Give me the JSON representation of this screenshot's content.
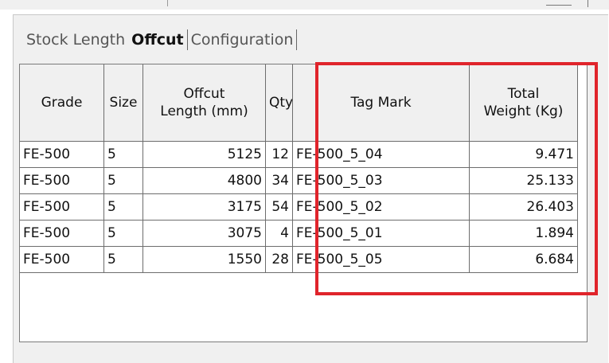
{
  "tabs": [
    "Stock Length",
    "Offcut",
    "Configuration"
  ],
  "active_tab": "Offcut",
  "columns": {
    "grade": "Grade",
    "size": "Size",
    "offcut_line1": "Offcut",
    "offcut_line2": "Length (mm)",
    "qty": "Qty",
    "tag": "Tag Mark",
    "weight_line1": "Total",
    "weight_line2": "Weight (Kg)"
  },
  "rows": [
    {
      "grade": "FE-500",
      "size": "5",
      "length": "5125",
      "qty": "12",
      "tag": "FE-500_5_04",
      "weight": "9.471"
    },
    {
      "grade": "FE-500",
      "size": "5",
      "length": "4800",
      "qty": "34",
      "tag": "FE-500_5_03",
      "weight": "25.133"
    },
    {
      "grade": "FE-500",
      "size": "5",
      "length": "3175",
      "qty": "54",
      "tag": "FE-500_5_02",
      "weight": "26.403"
    },
    {
      "grade": "FE-500",
      "size": "5",
      "length": "3075",
      "qty": "4",
      "tag": "FE-500_5_01",
      "weight": "1.894"
    },
    {
      "grade": "FE-500",
      "size": "5",
      "length": "1550",
      "qty": "28",
      "tag": "FE-500_5_05",
      "weight": "6.684"
    }
  ],
  "highlight_color": "#e0242b"
}
